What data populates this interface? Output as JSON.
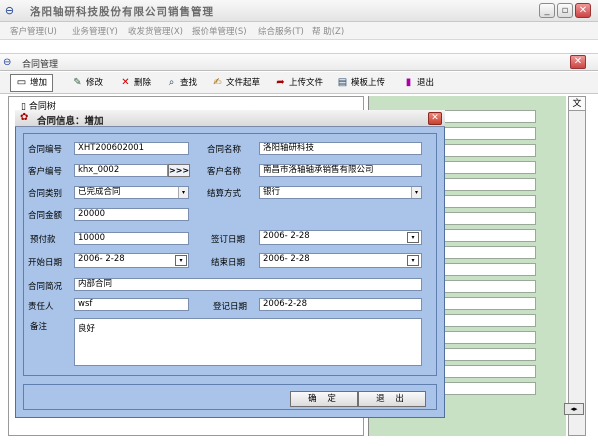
{
  "app": {
    "title": "洛阳轴研科技股份有限公司销售管理",
    "menu": [
      "客户管理(U)",
      "业务管理(Y)",
      "收发货管理(X)",
      "报价单管理(S)",
      "综合服务(T)",
      "帮 助(Z)"
    ]
  },
  "window": {
    "title": "合同管理"
  },
  "toolbar": {
    "add": "增加",
    "edit": "修改",
    "delete": "删除",
    "search": "查找",
    "draft": "文件起草",
    "upload": "上传文件",
    "template_upload": "模板上传",
    "exit": "退出"
  },
  "tree": {
    "root": "合同树"
  },
  "right_panel": {
    "col_header": "文"
  },
  "dialog": {
    "title": "合同信息：增加",
    "labels": {
      "contract_no": "合同编号",
      "contract_name": "合同名称",
      "customer_no": "客户编号",
      "customer_name": "客户名称",
      "contract_type": "合同类别",
      "settlement": "结算方式",
      "amount": "合同金额",
      "prepay": "预付款",
      "sign_date": "签订日期",
      "start_date": "开始日期",
      "end_date": "结束日期",
      "summary": "合同简况",
      "owner": "责任人",
      "reg_date": "登记日期",
      "remark": "备注"
    },
    "values": {
      "contract_no": "XHT200602001",
      "contract_name": "洛阳轴研科技",
      "customer_no": "khx_0002",
      "customer_pick": ">>>",
      "customer_name": "南昌市洛轴轴承销售有限公司",
      "contract_type": "已完成合同",
      "settlement": "银行",
      "amount": "20000",
      "prepay": "10000",
      "sign_date": "2006- 2-28",
      "start_date": "2006- 2-28",
      "end_date": "2006- 2-28",
      "summary": "内部合同",
      "owner": "wsf",
      "reg_date": "2006-2-28",
      "remark": "良好"
    },
    "buttons": {
      "ok": "确 定",
      "cancel": "退 出"
    }
  }
}
